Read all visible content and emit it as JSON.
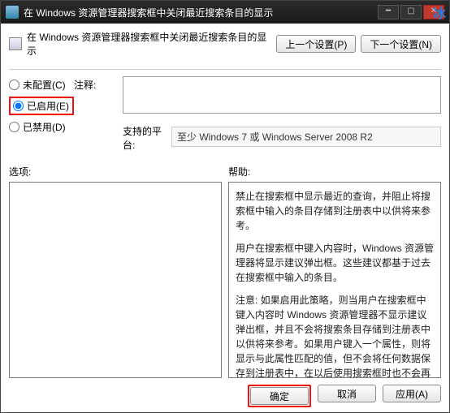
{
  "titlebar": {
    "text": "在 Windows 资源管理器搜索框中关闭最近搜索条目的显示"
  },
  "watermark": "冰",
  "header": {
    "title": "在 Windows 资源管理器搜索框中关闭最近搜索条目的显示"
  },
  "nav": {
    "prev": "上一个设置(P)",
    "next": "下一个设置(N)"
  },
  "radios": {
    "unconfigured": "未配置(C)",
    "enabled": "已启用(E)",
    "disabled": "已禁用(D)"
  },
  "labels": {
    "comment": "注释:",
    "platform": "支持的平台:",
    "options": "选项:",
    "help": "帮助:"
  },
  "platform": "至少 Windows 7 或 Windows Server 2008 R2",
  "help": {
    "p1": "禁止在搜索框中显示最近的查询，并阻止将搜索框中输入的条目存储到注册表中以供将来参考。",
    "p2": "用户在搜索框中键入内容时，Windows 资源管理器将显示建议弹出框。这些建议都基于过去在搜索框中输入的条目。",
    "p3": "注意: 如果启用此策略，则当用户在搜索框中键入内容时 Windows 资源管理器不显示建议弹出框，并且不会将搜索条目存储到注册表中以供将来参考。如果用户键入一个属性，则将显示与此属性匹配的值，但不会将任何数据保存到注册表中，在以后使用搜索框时也不会再显示这些数据。"
  },
  "footer": {
    "ok": "确定",
    "cancel": "取消",
    "apply": "应用(A)"
  }
}
